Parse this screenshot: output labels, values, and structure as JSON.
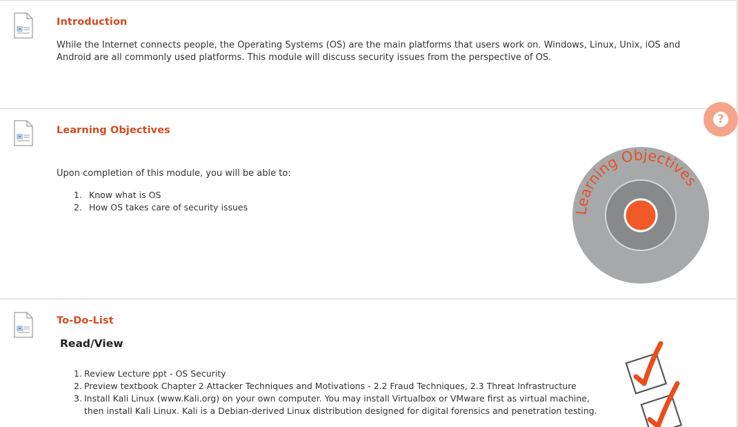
{
  "sections": {
    "introduction": {
      "title": "Introduction",
      "body": "While the Internet connects people, the Operating Systems (OS) are the main platforms that users work on.  Windows, Linux, Unix, iOS and Android are all commonly used platforms. This module will discuss security issues from the perspective of OS."
    },
    "learning_objectives": {
      "title": "Learning Objectives",
      "intro": "Upon completion of this module, you will be able to:",
      "items": [
        {
          "num": "1.",
          "text": "Know what is OS"
        },
        {
          "num": "2.",
          "text": "How OS takes care of security issues"
        }
      ],
      "graphic_text": "Learning Objectives"
    },
    "todo": {
      "title": "To-Do-List",
      "subheading": "Read/View",
      "items": [
        {
          "num": "1.",
          "text": "Review Lecture ppt - OS Security"
        },
        {
          "num": "2.",
          "text": "Preview textbook Chapter 2  Attacker Techniques and Motivations - 2.2  Fraud Techniques, 2.3  Threat Infrastructure"
        },
        {
          "num": "3.",
          "text": "Install Kali Linux (www.Kali.org) on your own computer. You may install Virtualbox or VMware first as virtual machine, then install Kali Linux.  Kali is a Debian-derived Linux distribution designed for digital forensics and penetration testing."
        }
      ]
    }
  },
  "help_button": {
    "glyph": "?"
  },
  "colors": {
    "accent": "#d34b1f",
    "target_center": "#f05a28",
    "target_outer": "#a7a8aa",
    "target_ring": "#88898b",
    "help": "#f3a48a"
  },
  "icons": [
    "document-icon",
    "question-icon",
    "target-icon",
    "checklist-icon"
  ]
}
